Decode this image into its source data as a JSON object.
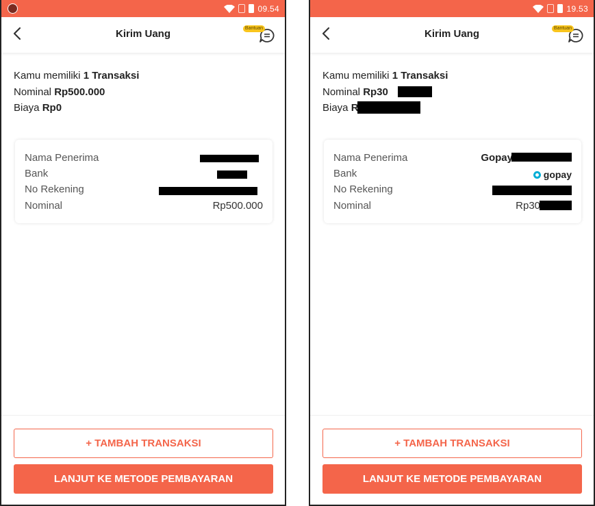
{
  "colors": {
    "accent": "#f4654a",
    "badge": "#f9c51c",
    "gopay_blue": "#00aed6"
  },
  "left": {
    "status": {
      "time": "09.54"
    },
    "header": {
      "title": "Kirim Uang",
      "help_badge": "Bantuan"
    },
    "summary": {
      "count_prefix": "Kamu memiliki ",
      "count_value": "1 Transaksi",
      "nominal_prefix": "Nominal ",
      "nominal_value": "Rp500.000",
      "fee_prefix": "Biaya ",
      "fee_value": "Rp0"
    },
    "details": {
      "recipient_label": "Nama Penerima",
      "bank_label": "Bank",
      "account_label": "No Rekening",
      "amount_label": "Nominal",
      "amount_value": "Rp500.000"
    },
    "actions": {
      "add_transaction": "+ TAMBAH TRANSAKSI",
      "continue_payment": "LANJUT KE METODE PEMBAYARAN"
    }
  },
  "right": {
    "status": {
      "time": "19.53"
    },
    "header": {
      "title": "Kirim Uang",
      "help_badge": "Bantuan"
    },
    "summary": {
      "count_prefix": "Kamu memiliki ",
      "count_value": "1 Transaksi",
      "nominal_prefix": "Nominal ",
      "nominal_value": "Rp30",
      "fee_prefix": "Biaya ",
      "fee_value": "R"
    },
    "details": {
      "recipient_label": "Nama Penerima",
      "recipient_value": "Gopay",
      "bank_label": "Bank",
      "bank_value": "gopay",
      "account_label": "No Rekening",
      "amount_label": "Nominal",
      "amount_value": "Rp30"
    },
    "actions": {
      "add_transaction": "+ TAMBAH TRANSAKSI",
      "continue_payment": "LANJUT KE METODE PEMBAYARAN"
    }
  }
}
